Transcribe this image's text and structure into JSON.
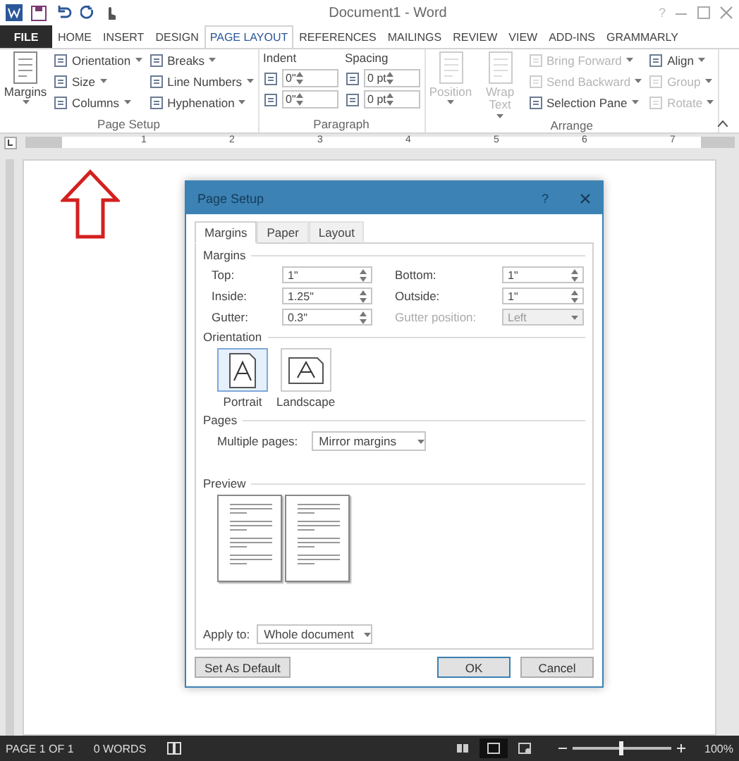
{
  "window": {
    "title": "Document1 - Word",
    "help": "?"
  },
  "tabs": [
    {
      "label": "FILE",
      "kind": "file",
      "selected": false
    },
    {
      "label": "HOME",
      "kind": "tab",
      "selected": false
    },
    {
      "label": "INSERT",
      "kind": "tab",
      "selected": false
    },
    {
      "label": "DESIGN",
      "kind": "tab",
      "selected": false
    },
    {
      "label": "PAGE LAYOUT",
      "kind": "tab",
      "selected": true
    },
    {
      "label": "REFERENCES",
      "kind": "tab",
      "selected": false
    },
    {
      "label": "MAILINGS",
      "kind": "tab",
      "selected": false
    },
    {
      "label": "REVIEW",
      "kind": "tab",
      "selected": false
    },
    {
      "label": "VIEW",
      "kind": "tab",
      "selected": false
    },
    {
      "label": "ADD-INS",
      "kind": "tab",
      "selected": false
    },
    {
      "label": "GRAMMARLY",
      "kind": "tab",
      "selected": false
    }
  ],
  "ribbon": {
    "groups": [
      {
        "label": "Page Setup",
        "columns": [
          [
            {
              "kind": "large",
              "label": "Margins",
              "disabled": false
            }
          ],
          [
            {
              "kind": "small",
              "label": "Orientation",
              "disabled": false
            },
            {
              "kind": "small",
              "label": "Size",
              "disabled": false
            },
            {
              "kind": "small",
              "label": "Columns",
              "disabled": false
            }
          ],
          [
            {
              "kind": "small",
              "label": "Breaks",
              "disabled": false
            },
            {
              "kind": "small",
              "label": "Line Numbers",
              "disabled": false
            },
            {
              "kind": "small",
              "label": "Hyphenation",
              "disabled": false
            }
          ]
        ]
      },
      {
        "label": "Paragraph",
        "columns": [
          [
            {
              "kind": "heading",
              "label": "Indent"
            },
            {
              "kind": "spinner",
              "label": "0\""
            },
            {
              "kind": "spinner",
              "label": "0\""
            }
          ],
          [
            {
              "kind": "heading",
              "label": "Spacing"
            },
            {
              "kind": "spinner",
              "label": "0 pt"
            },
            {
              "kind": "spinner",
              "label": "0 pt"
            }
          ]
        ]
      },
      {
        "label": "Arrange",
        "columns": [
          [
            {
              "kind": "large",
              "label": "Position",
              "disabled": true
            }
          ],
          [
            {
              "kind": "large",
              "label": "Wrap Text",
              "disabled": true
            }
          ],
          [
            {
              "kind": "small",
              "label": "Bring Forward",
              "disabled": true
            },
            {
              "kind": "small",
              "label": "Send Backward",
              "disabled": true
            },
            {
              "kind": "small",
              "label": "Selection Pane",
              "disabled": false
            }
          ],
          [
            {
              "kind": "small",
              "label": "Align",
              "disabled": false
            },
            {
              "kind": "small",
              "label": "Group",
              "disabled": true
            },
            {
              "kind": "small",
              "label": "Rotate",
              "disabled": true
            }
          ]
        ]
      }
    ]
  },
  "ruler": {
    "numbers": [
      "1",
      "2",
      "3",
      "4",
      "5",
      "6",
      "7"
    ]
  },
  "dialog": {
    "title": "Page Setup",
    "help": "?",
    "tabs": [
      {
        "label": "Margins",
        "selected": true
      },
      {
        "label": "Paper",
        "selected": false
      },
      {
        "label": "Layout",
        "selected": false
      }
    ],
    "margins_heading": "Margins",
    "fields": [
      {
        "label": "Top:",
        "value": "1\"",
        "disabled": false
      },
      {
        "label": "Bottom:",
        "value": "1\"",
        "disabled": false
      },
      {
        "label": "Inside:",
        "value": "1.25\"",
        "disabled": false
      },
      {
        "label": "Outside:",
        "value": "1\"",
        "disabled": false
      },
      {
        "label": "Gutter:",
        "value": "0.3\"",
        "disabled": false
      },
      {
        "label": "Gutter position:",
        "value": "Left",
        "disabled": true
      }
    ],
    "orientation_heading": "Orientation",
    "orientations": [
      {
        "label": "Portrait",
        "selected": true
      },
      {
        "label": "Landscape",
        "selected": false
      }
    ],
    "pages_heading": "Pages",
    "multiple_pages_label": "Multiple pages:",
    "multiple_pages": "Mirror margins",
    "preview_heading": "Preview",
    "apply_to_label": "Apply to:",
    "apply_to": "Whole document",
    "buttons": [
      {
        "label": "Set As Default",
        "default": false
      },
      {
        "label": "OK",
        "default": true
      },
      {
        "label": "Cancel",
        "default": false
      }
    ]
  },
  "status_bar": {
    "page": "PAGE 1 OF 1",
    "words": "0 WORDS",
    "views": [
      {
        "kind": "read",
        "selected": false
      },
      {
        "kind": "print",
        "selected": true
      },
      {
        "kind": "web",
        "selected": false
      }
    ],
    "zoom": {
      "level": 0.5,
      "reading": "100%"
    }
  }
}
